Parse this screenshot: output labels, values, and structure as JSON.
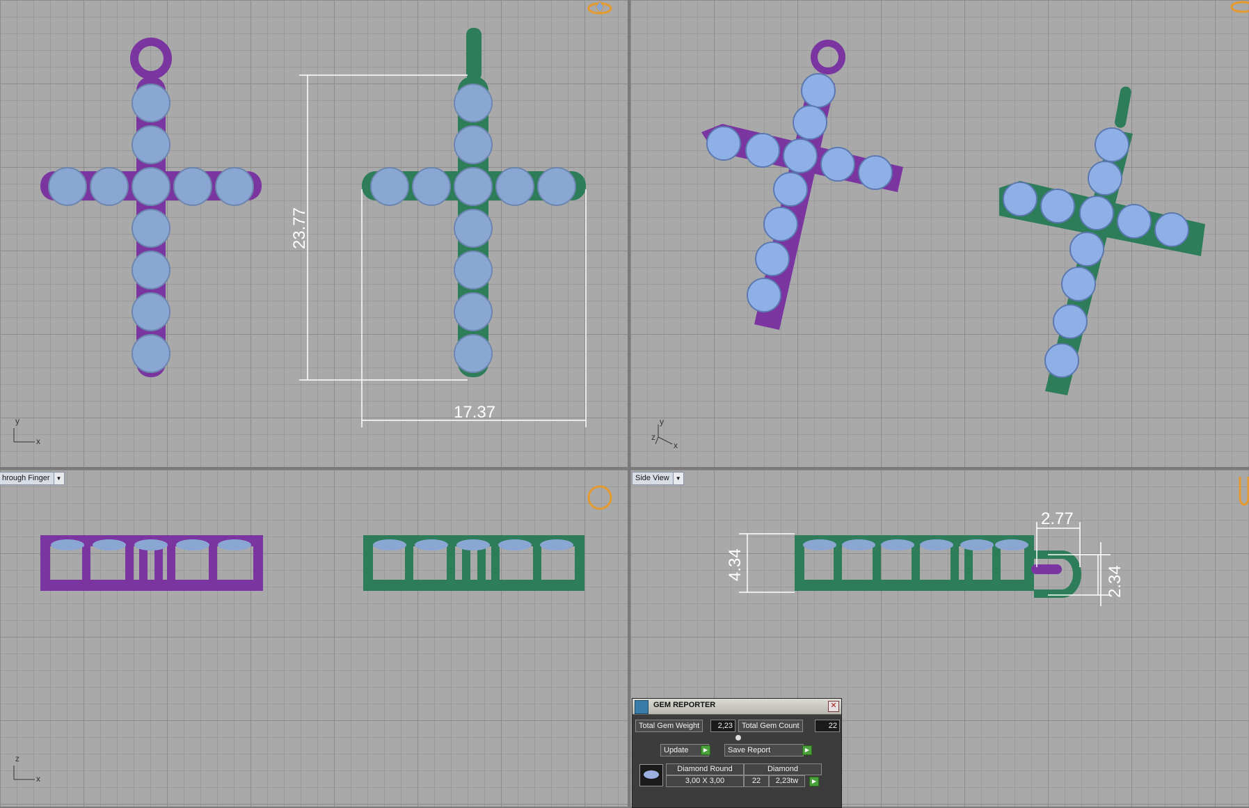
{
  "viewports": {
    "top": {
      "axes": {
        "y": "y",
        "x": "x"
      }
    },
    "perspective": {
      "axes": {
        "y": "y",
        "z": "z",
        "x": "x"
      }
    },
    "front": {
      "label": "hrough Finger",
      "axes": {
        "z": "z",
        "x": "x"
      }
    },
    "side": {
      "label": "Side View"
    }
  },
  "dimensions": {
    "height": "23.77",
    "width": "17.37",
    "side_depth": "4.34",
    "side_loop_width": "2.77",
    "side_loop_height": "2.34"
  },
  "gem_reporter": {
    "title": "GEM REPORTER",
    "close": "✕",
    "total_weight_label": "Total Gem Weight",
    "total_weight_value": "2,23",
    "total_count_label": "Total Gem Count",
    "total_count_value": "22",
    "update_label": "Update",
    "save_report_label": "Save Report",
    "row": {
      "shape": "Diamond Round",
      "size": "3,00 X 3,00",
      "material": "Diamond",
      "count": "22",
      "weight": "2,23tw"
    }
  },
  "colors": {
    "purple_metal": "#7a35a0",
    "green_metal": "#2e7d5a",
    "gem": "#8aa6d2",
    "viewport_bg": "#a9a9a9"
  }
}
